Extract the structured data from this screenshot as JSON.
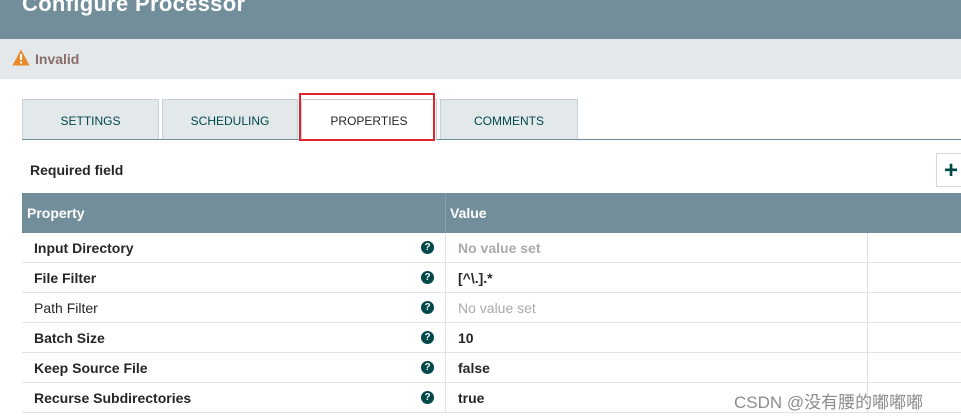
{
  "header": {
    "title": "Configure Processor"
  },
  "status": {
    "icon": "warning-triangle-icon",
    "text": "Invalid",
    "color": "#e98a2a"
  },
  "tabs": [
    {
      "label": "SETTINGS",
      "active": false
    },
    {
      "label": "SCHEDULING",
      "active": false
    },
    {
      "label": "PROPERTIES",
      "active": true
    },
    {
      "label": "COMMENTS",
      "active": false
    }
  ],
  "properties": {
    "required_label": "Required field",
    "add_button": "+",
    "columns": {
      "property": "Property",
      "value": "Value"
    },
    "rows": [
      {
        "name": "Input Directory",
        "value": "No value set",
        "required": true,
        "empty": true
      },
      {
        "name": "File Filter",
        "value": "[^\\.].*",
        "required": true,
        "empty": false
      },
      {
        "name": "Path Filter",
        "value": "No value set",
        "required": false,
        "empty": true
      },
      {
        "name": "Batch Size",
        "value": "10",
        "required": true,
        "empty": false
      },
      {
        "name": "Keep Source File",
        "value": "false",
        "required": true,
        "empty": false
      },
      {
        "name": "Recurse Subdirectories",
        "value": "true",
        "required": true,
        "empty": false
      }
    ]
  },
  "watermark": "CSDN @没有腰的嘟嘟嘟"
}
